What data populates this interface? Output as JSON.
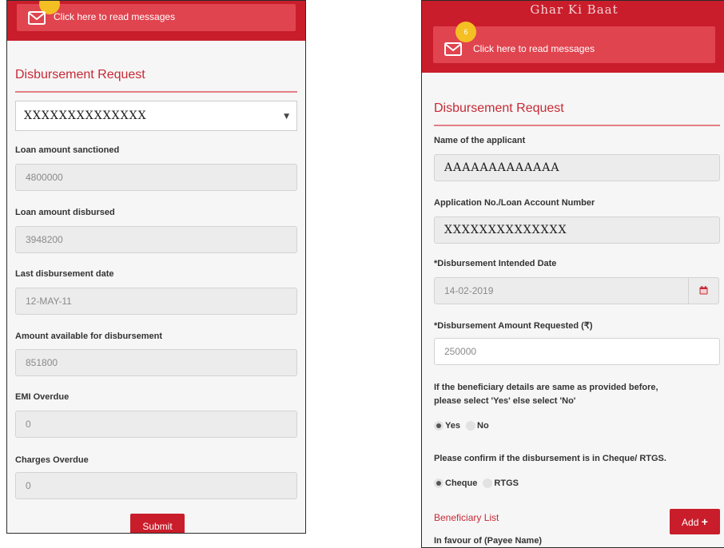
{
  "left": {
    "message_bar": {
      "text": "Click here to read messages"
    },
    "section_title": "Disbursement Request",
    "selected_loan": "XXXXXXXXXXXXXX",
    "fields": {
      "loan_sanctioned": {
        "label": "Loan amount sanctioned",
        "value": "4800000"
      },
      "loan_disbursed": {
        "label": "Loan amount disbursed",
        "value": "3948200"
      },
      "last_date": {
        "label": "Last disbursement date",
        "value": "12-MAY-11"
      },
      "available": {
        "label": "Amount available for disbursement",
        "value": "851800"
      },
      "emi_overdue": {
        "label": "EMI Overdue",
        "value": "0"
      },
      "charges_overdue": {
        "label": "Charges Overdue",
        "value": "0"
      }
    },
    "submit_label": "Submit"
  },
  "right": {
    "app_title": "Ghar Ki Baat",
    "message_bar": {
      "text": "Click here to read messages",
      "badge": "6"
    },
    "section_title": "Disbursement Request",
    "applicant": {
      "label": "Name of the applicant",
      "value": "AAAAAAAAAAAAA"
    },
    "application_no": {
      "label": "Application No./Loan Account Number",
      "value": "XXXXXXXXXXXXXX"
    },
    "intended_date": {
      "label": "*Disbursement Intended Date",
      "value": "14-02-2019"
    },
    "amount_requested": {
      "label": "*Disbursement Amount Requested (₹)",
      "value": "250000"
    },
    "beneficiary_question": {
      "line1": "If the beneficiary details are same as provided before,",
      "line2": "please select 'Yes' else select 'No'",
      "options": [
        "Yes",
        "No"
      ],
      "selected": "Yes"
    },
    "mode_question": {
      "text": "Please confirm if the disbursement is in Cheque/ RTGS.",
      "options": [
        "Cheque",
        "RTGS"
      ],
      "selected": "Cheque"
    },
    "beneficiary_list": {
      "label": "Beneficiary List",
      "add_label": "Add"
    },
    "payee_label": "In favour of (Payee Name)"
  },
  "colors": {
    "brand_red": "#c91d2b",
    "message_bar": "#e0444f",
    "badge": "#f4bf23",
    "accent_text": "#c62a36"
  },
  "icons": {
    "message": "envelope-icon",
    "calendar": "calendar-icon",
    "add": "plus-icon",
    "dropdown": "caret-down-icon"
  }
}
